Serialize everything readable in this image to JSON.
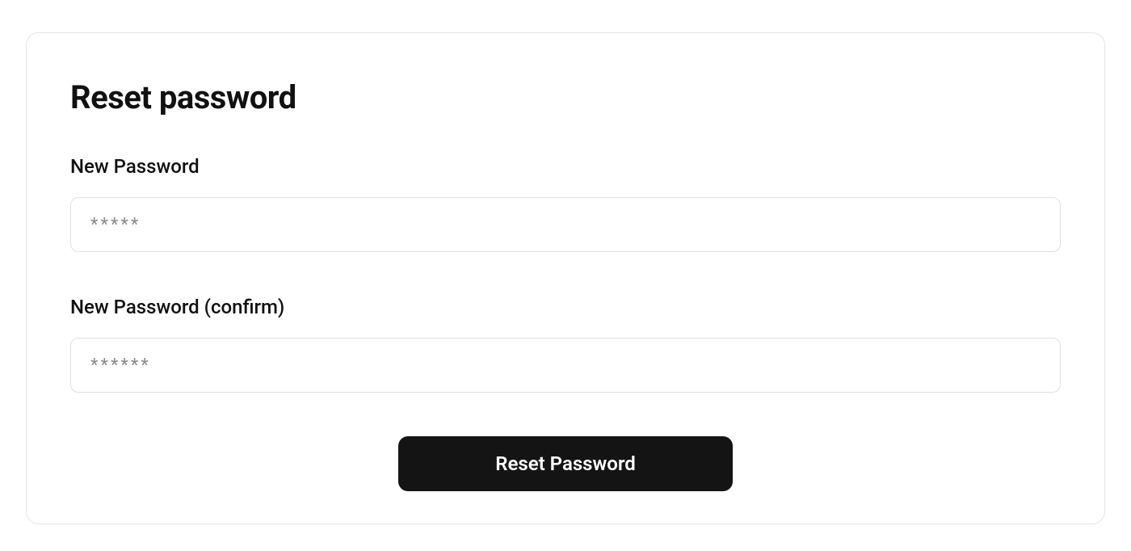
{
  "form": {
    "title": "Reset password",
    "new_password": {
      "label": "New Password",
      "placeholder": "*****",
      "value": ""
    },
    "confirm_password": {
      "label": "New Password (confirm)",
      "placeholder": "******",
      "value": ""
    },
    "submit_label": "Reset Password"
  }
}
